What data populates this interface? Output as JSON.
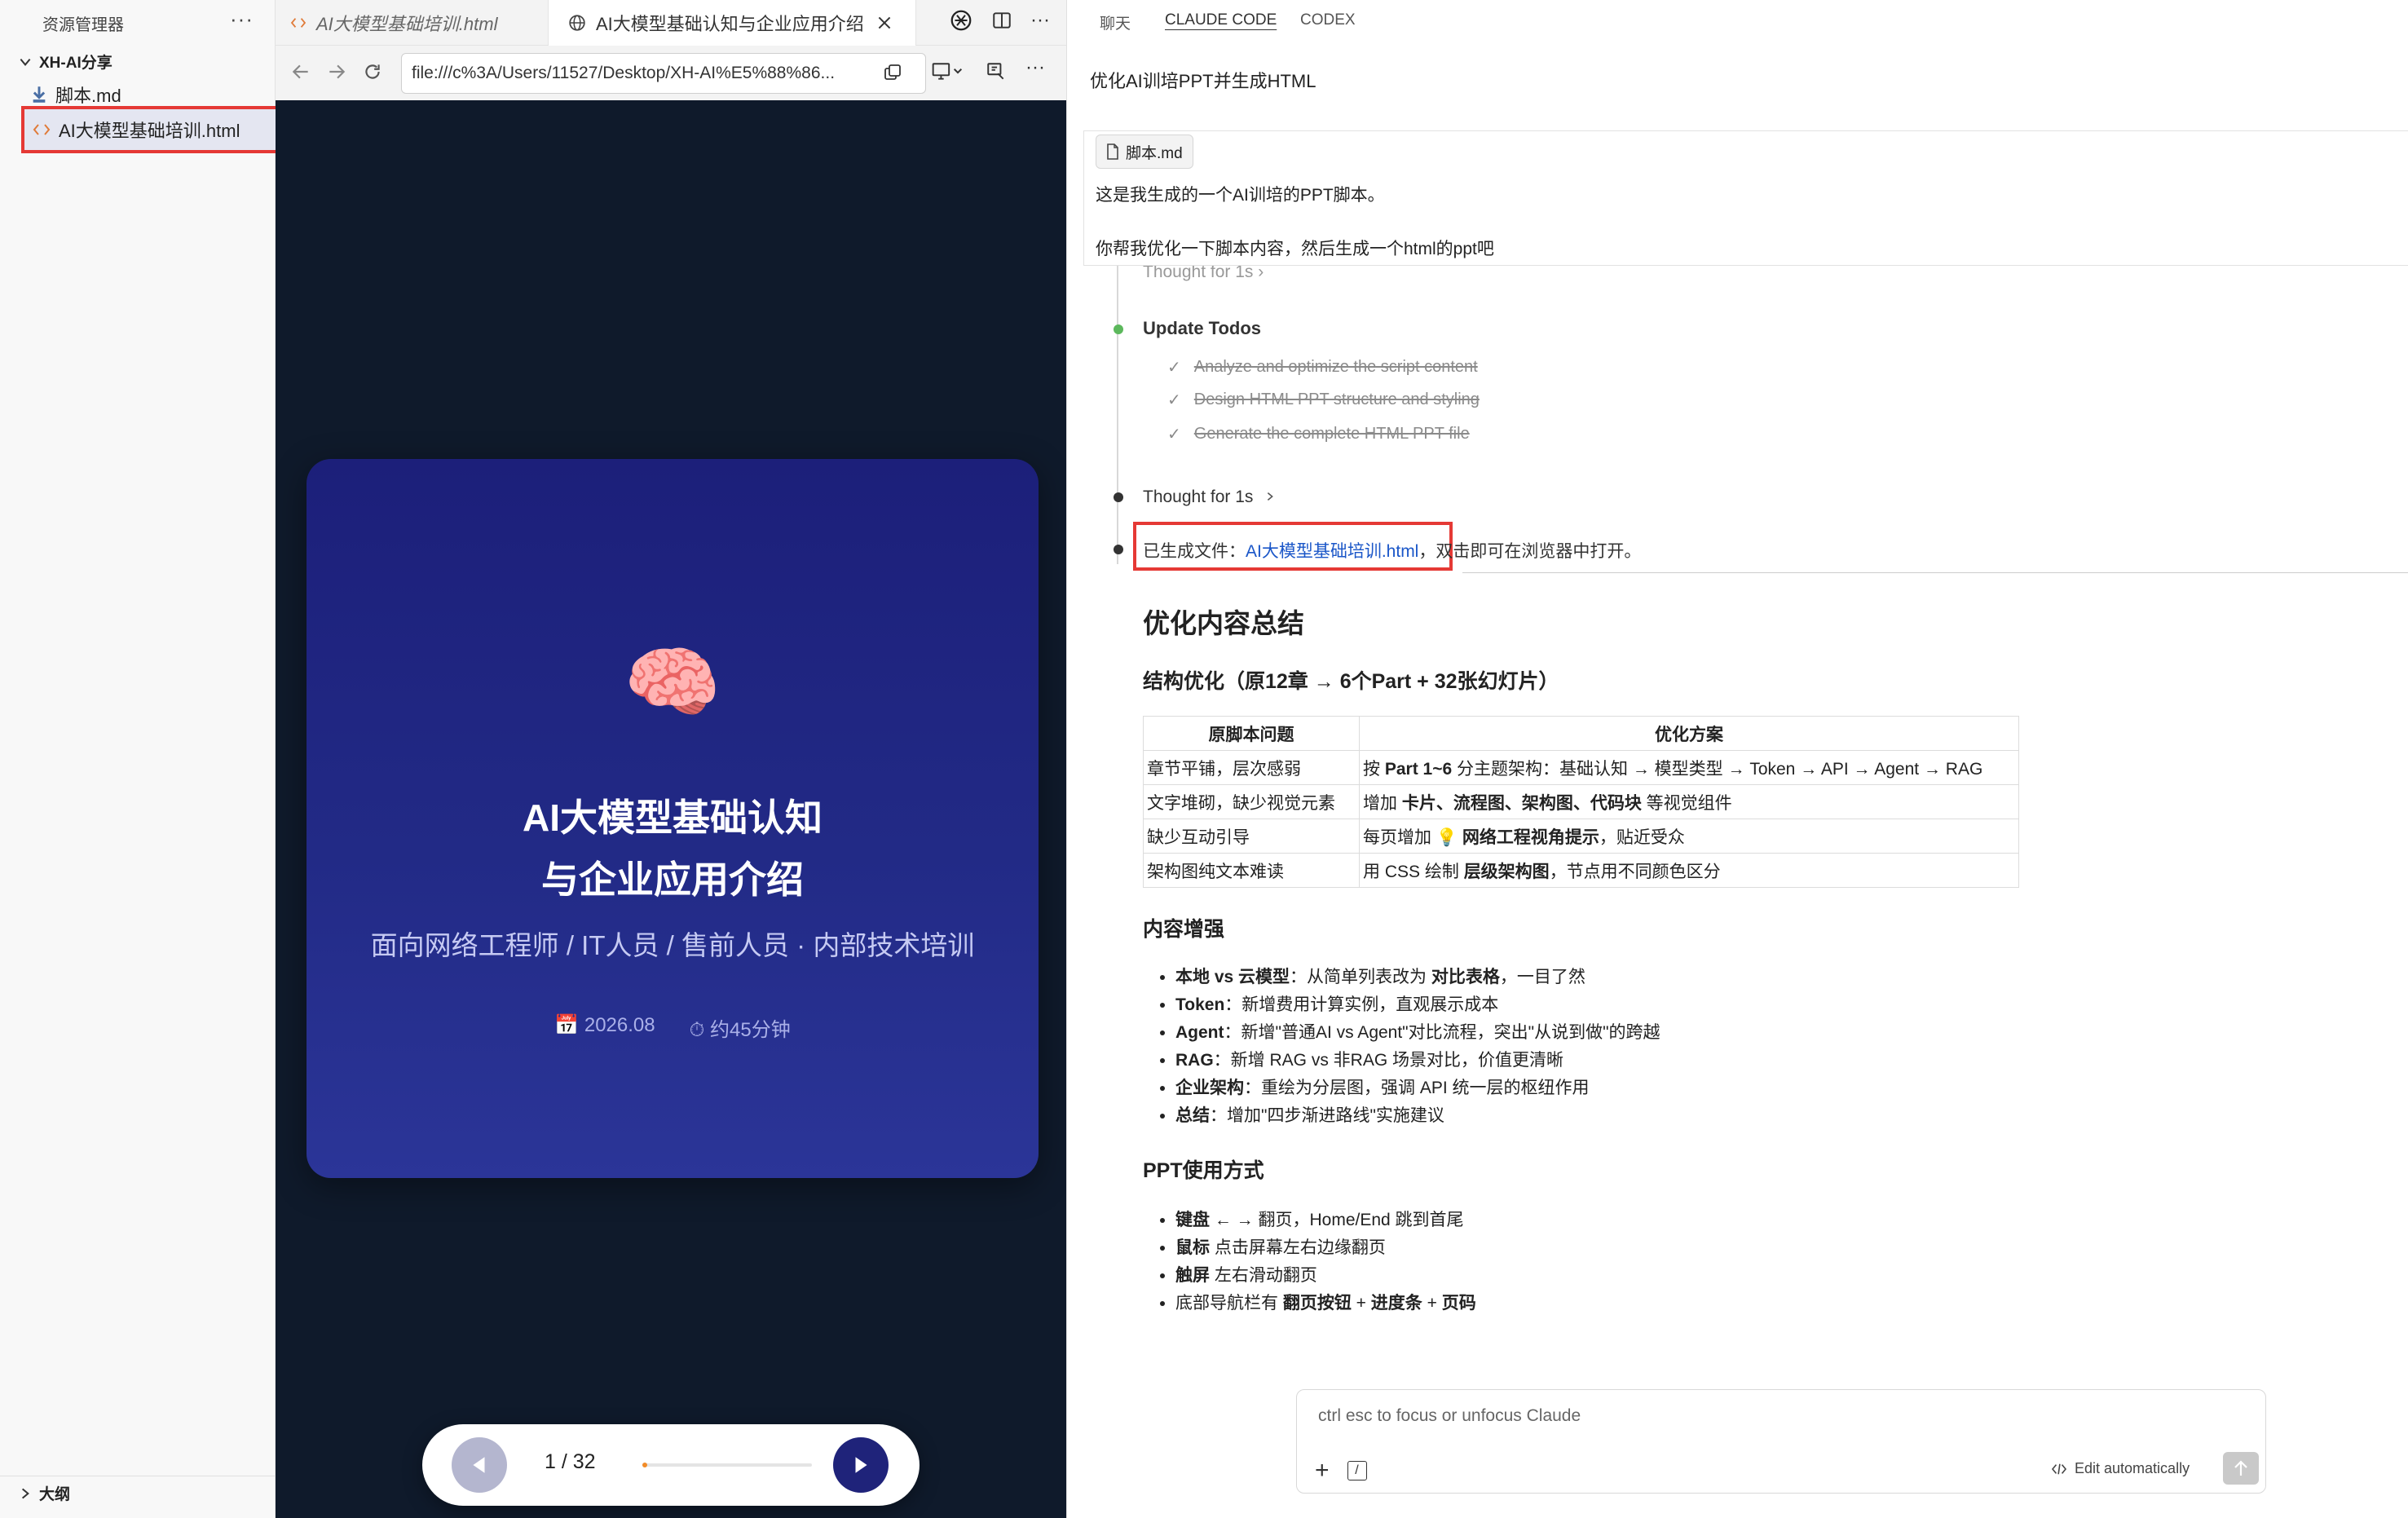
{
  "explorer": {
    "title": "资源管理器",
    "more": "···",
    "folder": "XH-AI分享",
    "files": [
      {
        "name": "脚本.md"
      },
      {
        "name": "AI大模型基础培训.html"
      }
    ],
    "outline": "大纲"
  },
  "browser": {
    "tabs": [
      {
        "label": "AI大模型基础培训.html"
      },
      {
        "label": "AI大模型基础认知与企业应用介绍"
      }
    ],
    "more": "···",
    "url": "file:///c%3A/Users/11527/Desktop/XH-AI%E5%88%86..."
  },
  "slide": {
    "emoji": "🧠",
    "title_line1": "AI大模型基础认知",
    "title_line2": "与企业应用介绍",
    "subtitle": "面向网络工程师 / IT人员 / 售前人员 · 内部技术培训",
    "date": "2026.08",
    "date_icon": "📅",
    "duration": "约45分钟",
    "duration_icon": "⏱"
  },
  "slide_nav": {
    "page": "1 / 32",
    "progress": 0.031
  },
  "panel": {
    "tabs": [
      {
        "label": "聊天"
      },
      {
        "label": "CLAUDE CODE"
      },
      {
        "label": "CODEX"
      }
    ],
    "title": "优化AI训培PPT并生成HTML",
    "user_message": {
      "attachment": "脚本.md",
      "line1": "这是我生成的一个AI训培的PPT脚本。",
      "line2": "你帮我优化一下脚本内容，然后生成一个html的ppt吧"
    },
    "thought_partial": "Thought for 1s",
    "update_todos": "Update Todos",
    "todos": [
      {
        "check": "✓",
        "text": "Analyze and optimize the script content"
      },
      {
        "check": "✓",
        "text": "Design HTML PPT structure and styling"
      },
      {
        "check": "✓",
        "text": "Generate the complete HTML PPT file"
      }
    ],
    "thought": "Thought for 1s",
    "generated_prefix": "已生成文件：",
    "generated_link": "AI大模型基础培训.html",
    "generated_suffix": "，双击即可在浏览器中打开。",
    "summary_title": "优化内容总结",
    "structure_title": "结构优化（原12章 → 6个Part + 32张幻灯片）",
    "table": {
      "headers": [
        "原脚本问题",
        "优化方案"
      ],
      "rows": [
        {
          "problem": "章节平铺，层次感弱",
          "pre": "按 ",
          "bold": "Part 1~6",
          "post": " 分主题架构：基础认知 → 模型类型 → Token → API → Agent → RAG"
        },
        {
          "problem": "文字堆砌，缺少视觉元素",
          "pre": "增加 ",
          "bold": "卡片、流程图、架构图、代码块",
          "post": " 等视觉组件"
        },
        {
          "problem": "缺少互动引导",
          "pre": "每页增加 💡 ",
          "bold": "网络工程视角提示",
          "post": "，贴近受众"
        },
        {
          "problem": "架构图纯文本难读",
          "pre": "用 CSS 绘制 ",
          "bold": "层级架构图",
          "post": "，节点用不同颜色区分"
        }
      ]
    },
    "content_title": "内容增强",
    "content_items": [
      {
        "bold": "本地 vs 云模型",
        "pre": "：从简单列表改为 ",
        "bold2": "对比表格",
        "post": "，一目了然"
      },
      {
        "bold": "Token",
        "pre": "：新增费用计算实例，直观展示成本",
        "bold2": "",
        "post": ""
      },
      {
        "bold": "Agent",
        "pre": "：新增\"普通AI vs Agent\"对比流程，突出\"从说到做\"的跨越",
        "bold2": "",
        "post": ""
      },
      {
        "bold": "RAG",
        "pre": "：新增 RAG vs 非RAG 场景对比，价值更清晰",
        "bold2": "",
        "post": ""
      },
      {
        "bold": "企业架构",
        "pre": "：重绘为分层图，强调 API 统一层的枢纽作用",
        "bold2": "",
        "post": ""
      },
      {
        "bold": "总结",
        "pre": "：增加\"四步渐进路线\"实施建议",
        "bold2": "",
        "post": ""
      }
    ],
    "usage_title": "PPT使用方式",
    "usage_items": [
      {
        "bold": "键盘",
        "text": " ← → 翻页，Home/End 跳到首尾",
        "b2": "",
        "t2": "",
        "b3": ""
      },
      {
        "bold": "鼠标",
        "text": " 点击屏幕左右边缘翻页",
        "b2": "",
        "t2": "",
        "b3": ""
      },
      {
        "bold": "触屏",
        "text": " 左右滑动翻页",
        "b2": "",
        "t2": "",
        "b3": ""
      },
      {
        "bold": "",
        "text": "底部导航栏有 ",
        "b2": "翻页按钮",
        "t2": " + ",
        "b3": "进度条"
      },
      {
        "bold": "",
        "text": "",
        "b2": "",
        "t2": " + ",
        "b3": "页码"
      }
    ],
    "input": {
      "placeholder": "ctrl esc to focus or unfocus Claude",
      "plus": "+",
      "slash": "/",
      "auto": "Edit automatically"
    }
  },
  "colors": {
    "accent_link": "#1a56c8",
    "highlight_box": "#e53935",
    "slide_bg": "#1f237a",
    "page_bg": "#0f1a2b",
    "progress_fill": "#f28c28",
    "done_dot": "#5cb85c"
  }
}
